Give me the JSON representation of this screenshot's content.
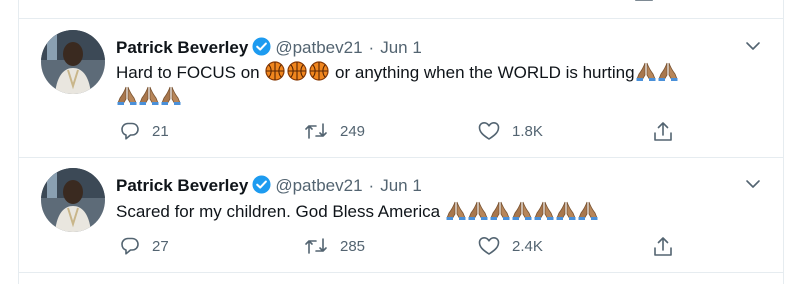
{
  "tweets": [
    {
      "name": "Patrick Beverley",
      "handle": "@patbev21",
      "separator": "·",
      "date": "Jun 1",
      "text_before": "Hard to FOCUS on ",
      "text_middle": " or anything when the WORLD is hurting",
      "emoji_inline": [
        "basketball",
        "basketball",
        "basketball"
      ],
      "emoji_trailing": [
        "folded-hands-medium-dark",
        "folded-hands-medium-dark",
        "folded-hands-medium-dark",
        "folded-hands-medium-dark",
        "folded-hands-medium-dark"
      ],
      "replies": "21",
      "retweets": "249",
      "likes": "1.8K"
    },
    {
      "name": "Patrick Beverley",
      "handle": "@patbev21",
      "separator": "·",
      "date": "Jun 1",
      "text_before": "Scared for my children. God Bless America ",
      "emoji_trailing": [
        "folded-hands-medium-dark",
        "folded-hands-medium-dark",
        "folded-hands-medium-dark",
        "folded-hands-medium-dark",
        "folded-hands-medium-dark",
        "folded-hands-medium-dark",
        "folded-hands-medium-dark"
      ],
      "replies": "27",
      "retweets": "285",
      "likes": "2.4K"
    }
  ],
  "icons": {
    "verified": "verified-badge-icon",
    "caret": "chevron-down-icon",
    "reply": "reply-icon",
    "retweet": "retweet-icon",
    "like": "heart-icon",
    "share": "share-icon"
  },
  "colors": {
    "verified": "#1d9bf0",
    "icon_gray": "#536471",
    "border": "#e6ecf0"
  }
}
